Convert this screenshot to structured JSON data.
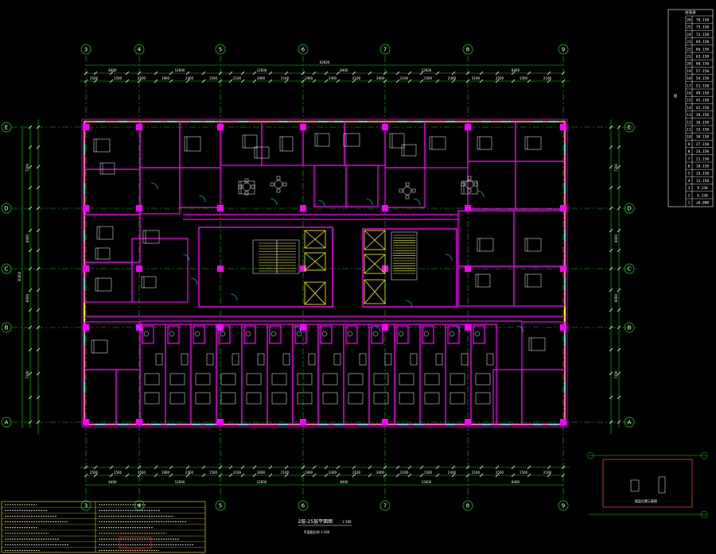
{
  "colors": {
    "background": "#000000",
    "axis": "#00d000",
    "dimension": "#00e000",
    "wall": "#ff00ff",
    "outer_wall": "#ffff00",
    "fixture": "#ffffff",
    "glass": "#00e0ff",
    "elevator": "#ffff00",
    "legend_frame": "#ffffff",
    "keyplan_frame": "#ff5040",
    "table_red": "#ff2000"
  },
  "axes": {
    "vertical": [
      "3",
      "4",
      "5",
      "6",
      "7",
      "8",
      "9"
    ],
    "horizontal": [
      "E",
      "D",
      "C",
      "B",
      "A"
    ]
  },
  "drawing_title": "2层-25层平面图",
  "drawing_scale": "1:100",
  "drawing_subtitle": "平面图比例 1:100",
  "keyplan_caption": "楼层位置示意图",
  "legend": {
    "header": "层高表",
    "side_label": "层",
    "rows": [
      {
        "n": "26",
        "h": "78.150"
      },
      {
        "n": "25",
        "h": "75.150"
      },
      {
        "n": "24",
        "h": "72.150"
      },
      {
        "n": "23",
        "h": "69.150"
      },
      {
        "n": "22",
        "h": "66.150"
      },
      {
        "n": "21",
        "h": "63.150"
      },
      {
        "n": "20",
        "h": "60.150"
      },
      {
        "n": "19",
        "h": "57.150"
      },
      {
        "n": "18",
        "h": "54.150"
      },
      {
        "n": "17",
        "h": "51.150"
      },
      {
        "n": "16",
        "h": "48.150"
      },
      {
        "n": "15",
        "h": "45.150"
      },
      {
        "n": "14",
        "h": "42.150"
      },
      {
        "n": "13",
        "h": "39.150"
      },
      {
        "n": "12",
        "h": "36.150"
      },
      {
        "n": "11",
        "h": "33.150"
      },
      {
        "n": "10",
        "h": "30.150"
      },
      {
        "n": "9",
        "h": "27.150"
      },
      {
        "n": "8",
        "h": "24.150"
      },
      {
        "n": "7",
        "h": "21.150"
      },
      {
        "n": "6",
        "h": "18.150"
      },
      {
        "n": "5",
        "h": "15.150"
      },
      {
        "n": "4",
        "h": "12.150"
      },
      {
        "n": "3",
        "h": "9.150"
      },
      {
        "n": "2",
        "h": "6.150"
      },
      {
        "n": "1",
        "h": "±0.000"
      }
    ]
  },
  "dimensions": {
    "top_total": "63600",
    "top_bays": [
      "8400",
      "12600",
      "12600",
      "8400",
      "12600",
      "8400"
    ],
    "left_total": "30400",
    "left_parts": [
      "7200",
      "6000",
      "6000",
      "7200"
    ]
  }
}
